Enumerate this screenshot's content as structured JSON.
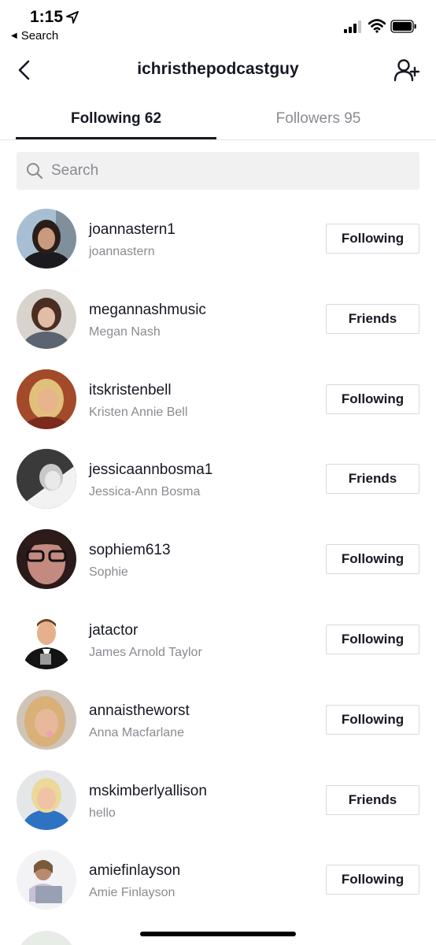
{
  "status_bar": {
    "time": "1:15",
    "back_app": "Search"
  },
  "header": {
    "title": "ichristhepodcastguy"
  },
  "tabs": [
    {
      "label": "Following 62",
      "active": true
    },
    {
      "label": "Followers 95",
      "active": false
    }
  ],
  "search": {
    "placeholder": "Search",
    "value": ""
  },
  "users": [
    {
      "username": "joannastern1",
      "display_name": "joannastern",
      "button": "Following"
    },
    {
      "username": "megannashmusic",
      "display_name": "Megan Nash",
      "button": "Friends"
    },
    {
      "username": "itskristenbell",
      "display_name": "Kristen Annie Bell",
      "button": "Following"
    },
    {
      "username": "jessicaannbosma1",
      "display_name": "Jessica-Ann Bosma",
      "button": "Friends"
    },
    {
      "username": "sophiem613",
      "display_name": "Sophie",
      "button": "Following"
    },
    {
      "username": "jatactor",
      "display_name": "James Arnold Taylor",
      "button": "Following"
    },
    {
      "username": "annaistheworst",
      "display_name": "Anna Macfarlane",
      "button": "Following"
    },
    {
      "username": "mskimberlyallison",
      "display_name": "hello",
      "button": "Friends"
    },
    {
      "username": "amiefinlayson",
      "display_name": "Amie Finlayson",
      "button": "Following"
    }
  ],
  "colors": {
    "text_primary": "#161823",
    "text_secondary": "#8a8b91",
    "search_bg": "#f1f1f2",
    "border": "#d9d9dc"
  }
}
